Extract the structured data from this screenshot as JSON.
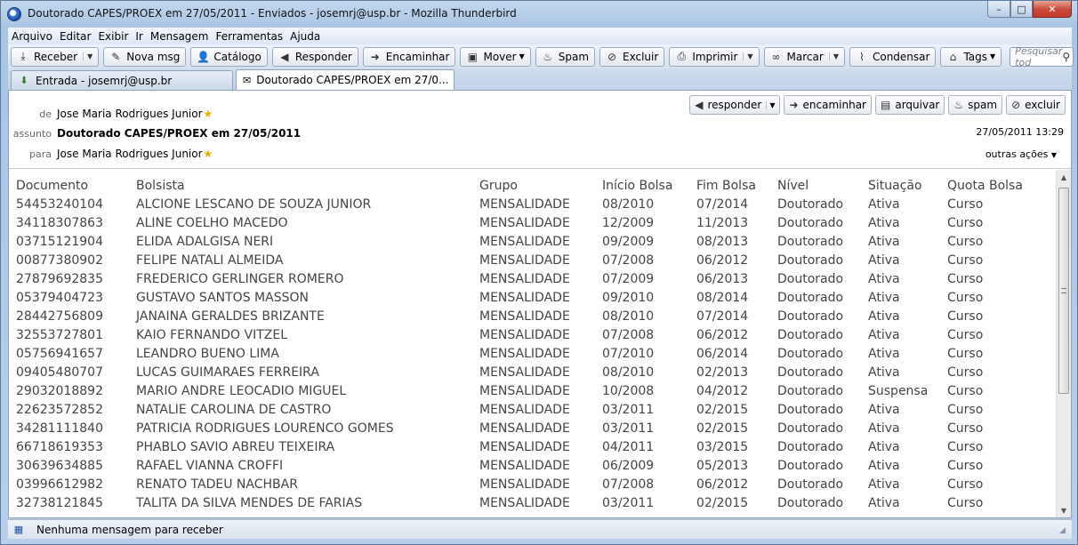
{
  "window": {
    "title": "Doutorado CAPES/PROEX em 27/05/2011 - Enviados - josemrj@usp.br - Mozilla Thunderbird",
    "min": "–",
    "max": "□",
    "close": "✕"
  },
  "menu": [
    {
      "label": "Arquivo"
    },
    {
      "label": "Editar"
    },
    {
      "label": "Exibir"
    },
    {
      "label": "Ir"
    },
    {
      "label": "Mensagem"
    },
    {
      "label": "Ferramentas"
    },
    {
      "label": "Ajuda"
    }
  ],
  "toolbar": {
    "receber": "Receber",
    "nova_msg": "Nova msg",
    "catalogo": "Catálogo",
    "responder": "Responder",
    "encaminhar": "Encaminhar",
    "mover": "Mover",
    "spam": "Spam",
    "excluir": "Excluir",
    "imprimir": "Imprimir",
    "marcar": "Marcar",
    "condensar": "Condensar",
    "tags": "Tags",
    "search_placeholder": "Pesquisar tod"
  },
  "tabs": {
    "inbox": "Entrada - josemrj@usp.br",
    "message": "Doutorado CAPES/PROEX em 27/0..."
  },
  "header": {
    "from_label": "de",
    "from_value": "Jose Maria Rodrigues Junior",
    "subject_label": "assunto",
    "subject_value": "Doutorado CAPES/PROEX em 27/05/2011",
    "to_label": "para",
    "to_value": "Jose Maria Rodrigues Junior",
    "date": "27/05/2011 13:29",
    "outras_acoes": "outras ações",
    "btn_responder": "responder",
    "btn_encaminhar": "encaminhar",
    "btn_arquivar": "arquivar",
    "btn_spam": "spam",
    "btn_excluir": "excluir"
  },
  "table": {
    "columns": [
      "Documento",
      "Bolsista",
      "Grupo",
      "Início Bolsa",
      "Fim Bolsa",
      "Nível",
      "Situação",
      "Quota Bolsa"
    ],
    "rows": [
      [
        "54453240104",
        "ALCIONE LESCANO DE SOUZA JUNIOR",
        "MENSALIDADE",
        "08/2010",
        "07/2014",
        "Doutorado",
        "Ativa",
        "Curso"
      ],
      [
        "34118307863",
        "ALINE COELHO MACEDO",
        "MENSALIDADE",
        "12/2009",
        "11/2013",
        "Doutorado",
        "Ativa",
        "Curso"
      ],
      [
        "03715121904",
        "ELIDA ADALGISA NERI",
        "MENSALIDADE",
        "09/2009",
        "08/2013",
        "Doutorado",
        "Ativa",
        "Curso"
      ],
      [
        "00877380902",
        "FELIPE NATALI ALMEIDA",
        "MENSALIDADE",
        "07/2008",
        "06/2012",
        "Doutorado",
        "Ativa",
        "Curso"
      ],
      [
        "27879692835",
        "FREDERICO GERLINGER ROMERO",
        "MENSALIDADE",
        "07/2009",
        "06/2013",
        "Doutorado",
        "Ativa",
        "Curso"
      ],
      [
        "05379404723",
        "GUSTAVO SANTOS MASSON",
        "MENSALIDADE",
        "09/2010",
        "08/2014",
        "Doutorado",
        "Ativa",
        "Curso"
      ],
      [
        "28442756809",
        "JANAINA GERALDES BRIZANTE",
        "MENSALIDADE",
        "08/2010",
        "07/2014",
        "Doutorado",
        "Ativa",
        "Curso"
      ],
      [
        "32553727801",
        "KAIO FERNANDO VITZEL",
        "MENSALIDADE",
        "07/2008",
        "06/2012",
        "Doutorado",
        "Ativa",
        "Curso"
      ],
      [
        "05756941657",
        "LEANDRO BUENO LIMA",
        "MENSALIDADE",
        "07/2010",
        "06/2014",
        "Doutorado",
        "Ativa",
        "Curso"
      ],
      [
        "09405480707",
        "LUCAS GUIMARAES FERREIRA",
        "MENSALIDADE",
        "08/2010",
        "02/2013",
        "Doutorado",
        "Ativa",
        "Curso"
      ],
      [
        "29032018892",
        "MARIO ANDRE LEOCADIO MIGUEL",
        "MENSALIDADE",
        "10/2008",
        "04/2012",
        "Doutorado",
        "Suspensa",
        "Curso"
      ],
      [
        "22623572852",
        "NATALIE CAROLINA DE CASTRO",
        "MENSALIDADE",
        "03/2011",
        "02/2015",
        "Doutorado",
        "Ativa",
        "Curso"
      ],
      [
        "34281111840",
        "PATRICIA RODRIGUES LOURENCO GOMES",
        "MENSALIDADE",
        "03/2011",
        "02/2015",
        "Doutorado",
        "Ativa",
        "Curso"
      ],
      [
        "66718619353",
        "PHABLO SAVIO ABREU TEIXEIRA",
        "MENSALIDADE",
        "04/2011",
        "03/2015",
        "Doutorado",
        "Ativa",
        "Curso"
      ],
      [
        "30639634885",
        "RAFAEL VIANNA CROFFI",
        "MENSALIDADE",
        "06/2009",
        "05/2013",
        "Doutorado",
        "Ativa",
        "Curso"
      ],
      [
        "03996612982",
        "RENATO TADEU NACHBAR",
        "MENSALIDADE",
        "07/2008",
        "06/2012",
        "Doutorado",
        "Ativa",
        "Curso"
      ],
      [
        "32738121845",
        "TALITA DA SILVA MENDES DE FARIAS",
        "MENSALIDADE",
        "03/2011",
        "02/2015",
        "Doutorado",
        "Ativa",
        "Curso"
      ]
    ]
  },
  "status": {
    "text": "Nenhuma mensagem para receber"
  }
}
